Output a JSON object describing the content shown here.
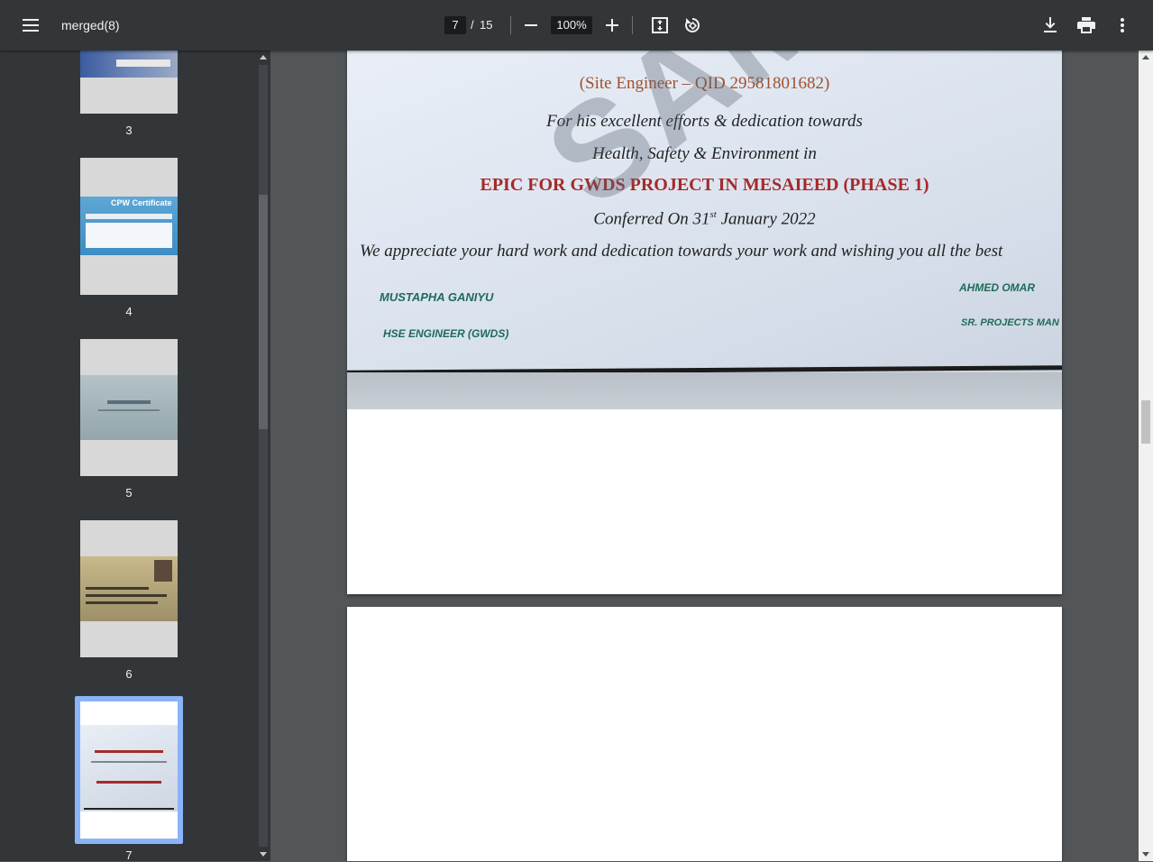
{
  "toolbar": {
    "title": "merged(8)",
    "current_page": "7",
    "page_separator": "/",
    "total_pages": "15",
    "zoom": "100%"
  },
  "sidebar": {
    "thumbnails": [
      {
        "label": "3",
        "title": "",
        "selected": false
      },
      {
        "label": "4",
        "title": "CPW Certificate",
        "selected": false
      },
      {
        "label": "5",
        "title": "",
        "selected": false
      },
      {
        "label": "6",
        "title": "",
        "selected": false
      },
      {
        "label": "7",
        "title": "",
        "selected": true
      }
    ]
  },
  "certificate": {
    "role_line": "(Site Engineer – QID 29581801682)",
    "line1": "For his excellent efforts & dedication towards",
    "line2": "Health, Safety & Environment in",
    "project": "EPIC FOR GWDS PROJECT IN MESAIEED (PHASE 1)",
    "conferred_prefix": "Conferred On 31",
    "conferred_sup": "st",
    "conferred_suffix": " January 2022",
    "appreciation": "We appreciate your hard work and dedication towards your work and wishing you all the best",
    "signer1_name": "MUSTAPHA GANIYU",
    "signer1_title": "HSE ENGINEER (GWDS)",
    "signer2_name": "AHMED OMAR",
    "signer2_title": "SR. PROJECTS MAN",
    "watermark": "SAMPLE"
  },
  "colors": {
    "toolbar_bg": "#323639",
    "viewer_bg": "#525659",
    "selection": "#8ab4f8",
    "cert_red": "#a52a2a",
    "cert_green": "#1f6b5a"
  }
}
